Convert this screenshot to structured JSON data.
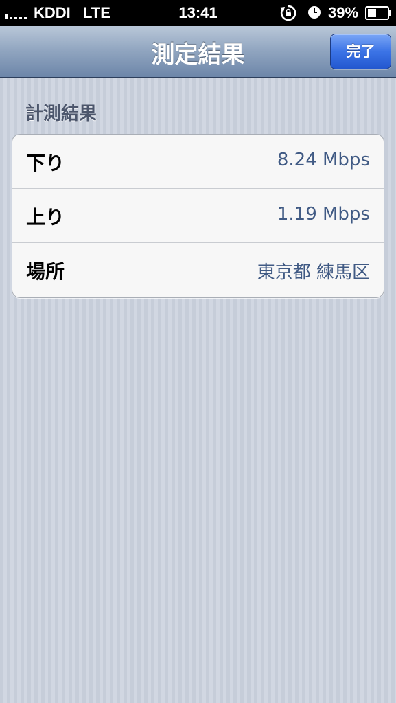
{
  "status_bar": {
    "carrier": "KDDI",
    "network": "LTE",
    "time": "13:41",
    "battery": "39%",
    "icons": [
      "signal-icon",
      "rotation-lock-icon",
      "alarm-icon",
      "battery-icon"
    ]
  },
  "nav": {
    "title": "測定結果",
    "done_label": "完了"
  },
  "section": {
    "header": "計測結果"
  },
  "rows": [
    {
      "label": "下り",
      "value": "8.24 Mbps"
    },
    {
      "label": "上り",
      "value": "1.19 Mbps"
    },
    {
      "label": "場所",
      "value": "東京都 練馬区"
    }
  ],
  "colors": {
    "accent_blue": "#2357cf",
    "value_text": "#405a84",
    "nav_gradient_top": "#b9c7d8",
    "nav_gradient_bottom": "#6d86a9"
  }
}
